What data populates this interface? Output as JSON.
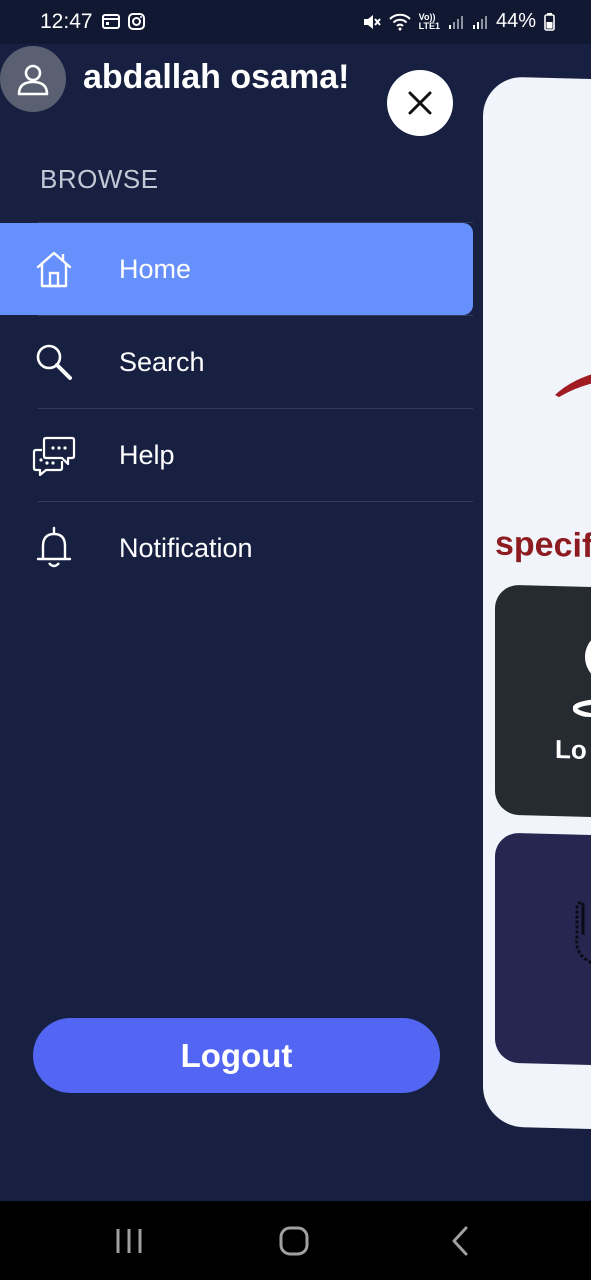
{
  "status_bar": {
    "time": "12:47",
    "battery": "44%",
    "left_icons": [
      "calendar-icon",
      "instagram-icon"
    ],
    "right_icons": [
      "mute-icon",
      "wifi-icon",
      "volte-icon",
      "signal-icon",
      "signal-icon",
      "battery-icon"
    ],
    "network_label_top": "Vo))",
    "network_label_bottom": "LTE1"
  },
  "drawer": {
    "username": "abdallah osama!",
    "section_title": "BROWSE",
    "items": [
      {
        "label": "Home",
        "icon": "home-icon",
        "active": true
      },
      {
        "label": "Search",
        "icon": "search-icon",
        "active": false
      },
      {
        "label": "Help",
        "icon": "chat-help-icon",
        "active": false
      },
      {
        "label": "Notification",
        "icon": "bell-icon",
        "active": false
      }
    ],
    "logout_label": "Logout"
  },
  "background_screen": {
    "title_fragment": "specif",
    "tile1_label_fragment": "Lo"
  },
  "colors": {
    "drawer_bg": "#172040",
    "active_item": "#6690fb",
    "logout_button": "#5266f3",
    "peek_title": "#8d1b1f",
    "card_bg": "#f1f4fb"
  },
  "nav_bar": {
    "buttons": [
      "recent-apps-icon",
      "home-button-icon",
      "back-icon"
    ]
  }
}
